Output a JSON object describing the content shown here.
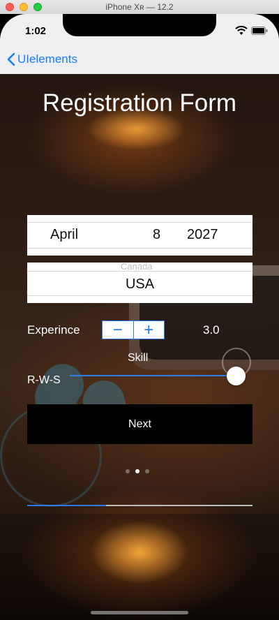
{
  "window": {
    "title": "iPhone Xʀ — 12.2"
  },
  "status_bar": {
    "time": "1:02"
  },
  "nav": {
    "back_label": "UIelements"
  },
  "form": {
    "title": "Registration Form",
    "date_picker": {
      "month": "April",
      "day": "8",
      "year": "2027"
    },
    "country_picker": {
      "selected": "USA",
      "above_ghost": "Canada"
    },
    "experience": {
      "label": "Experince",
      "minus": "−",
      "plus": "+",
      "value": "3.0"
    },
    "skill": {
      "label": "Skill",
      "slider_label": "R-W-S",
      "slider_value_fraction": 1.0
    },
    "next_label": "Next"
  },
  "page_indicator": {
    "count": 3,
    "active_index": 1
  },
  "progress": {
    "fraction": 0.35
  },
  "colors": {
    "accent": "#2e7be8",
    "ios_blue": "#147efb"
  }
}
